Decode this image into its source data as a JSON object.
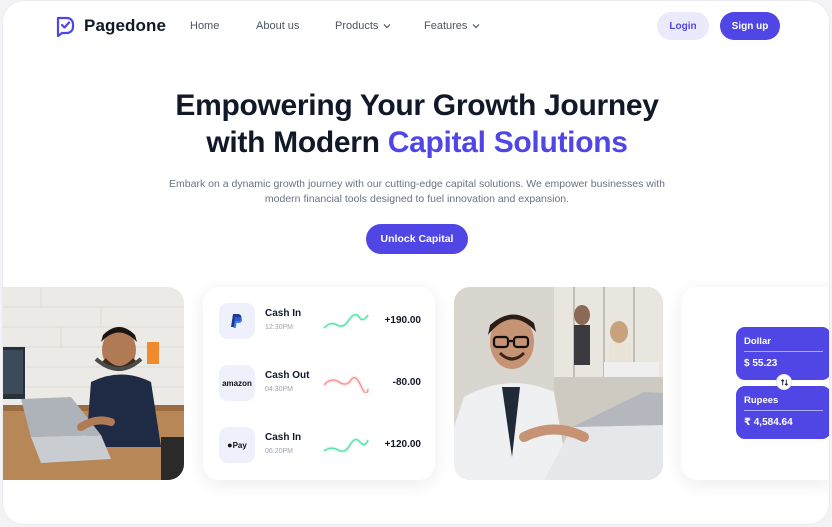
{
  "brand": {
    "name": "Pagedone",
    "accent": "#4f46e5"
  },
  "nav": {
    "home": "Home",
    "about": "About us",
    "products": "Products",
    "features": "Features"
  },
  "auth": {
    "login": "Login",
    "signup": "Sign up"
  },
  "hero": {
    "headline_line1": "Empowering Your Growth Journey",
    "headline_line2_prefix": "with Modern ",
    "headline_line2_accent": "Capital Solutions",
    "subtext": "Embark on a dynamic growth journey with our cutting-edge capital solutions. We empower businesses with modern financial tools designed to fuel innovation and expansion.",
    "cta": "Unlock Capital"
  },
  "transactions": [
    {
      "provider": "paypal-icon",
      "label": "Cash In",
      "time": "12:30PM",
      "amount": "+190.00",
      "trend_color": "#34d399"
    },
    {
      "provider": "amazon",
      "label": "Cash Out",
      "time": "04:30PM",
      "amount": "-80.00",
      "trend_color": "#f87171"
    },
    {
      "provider": "Pay",
      "label": "Cash In",
      "time": "06:20PM",
      "amount": "+120.00",
      "trend_color": "#34d399"
    }
  ],
  "converter": {
    "from_label": "Dollar",
    "from_value": "$ 55.23",
    "to_label": "Rupees",
    "to_value": "₹ 4,584.64"
  }
}
